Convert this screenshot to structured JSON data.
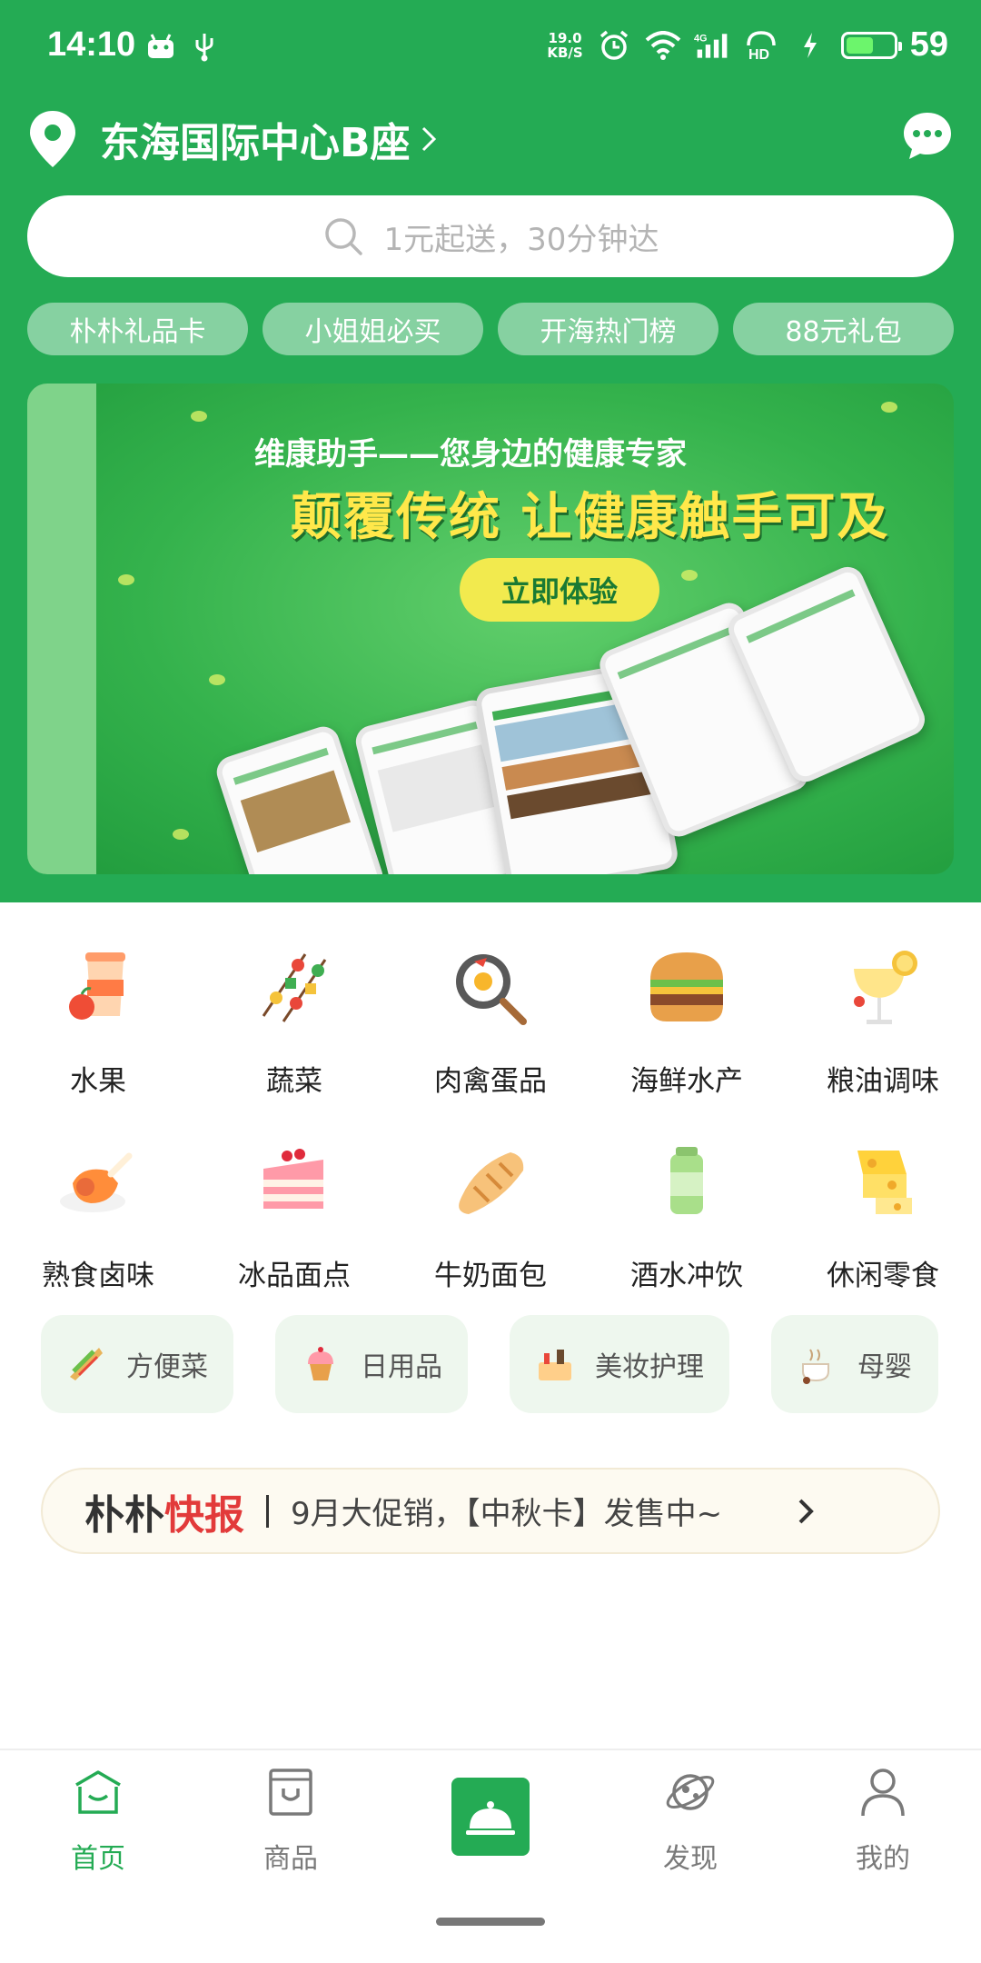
{
  "status_bar": {
    "time": "14:10",
    "net_speed_value": "19.0",
    "net_speed_unit": "KB/S",
    "battery_level": "59",
    "battery_fraction": 0.59
  },
  "header": {
    "location": "东海国际中心B座",
    "search_placeholder": "1元起送，30分钟达",
    "tags": [
      "朴朴礼品卡",
      "小姐姐必买",
      "开海热门榜",
      "88元礼包"
    ]
  },
  "banner": {
    "subtitle": "维康助手——您身边的健康专家",
    "title": "颠覆传统 让健康触手可及",
    "button": "立即体验"
  },
  "categories": [
    {
      "label": "水果",
      "icon": "fruit-icon"
    },
    {
      "label": "蔬菜",
      "icon": "vegetable-skewer-icon"
    },
    {
      "label": "肉禽蛋品",
      "icon": "fried-egg-pan-icon"
    },
    {
      "label": "海鲜水产",
      "icon": "burger-icon"
    },
    {
      "label": "粮油调味",
      "icon": "cocktail-icon"
    },
    {
      "label": "熟食卤味",
      "icon": "roast-chicken-icon"
    },
    {
      "label": "冰品面点",
      "icon": "cake-icon"
    },
    {
      "label": "牛奶面包",
      "icon": "croissant-icon"
    },
    {
      "label": "酒水冲饮",
      "icon": "drink-can-icon"
    },
    {
      "label": "休闲零食",
      "icon": "cheese-icon"
    }
  ],
  "pills": [
    {
      "label": "方便菜",
      "icon": "sandwich-icon"
    },
    {
      "label": "日用品",
      "icon": "cupcake-icon"
    },
    {
      "label": "美妆护理",
      "icon": "cosmetics-icon"
    },
    {
      "label": "母婴",
      "icon": "coffee-icon"
    }
  ],
  "news": {
    "brand_part1": "朴朴",
    "brand_part2": "快报",
    "text": "9月大促销，【中秋卡】发售中~"
  },
  "nav": {
    "home": "首页",
    "products": "商品",
    "discover": "发现",
    "mine": "我的"
  },
  "colors": {
    "brand_green": "#24ab54",
    "news_red": "#e23a3a"
  }
}
